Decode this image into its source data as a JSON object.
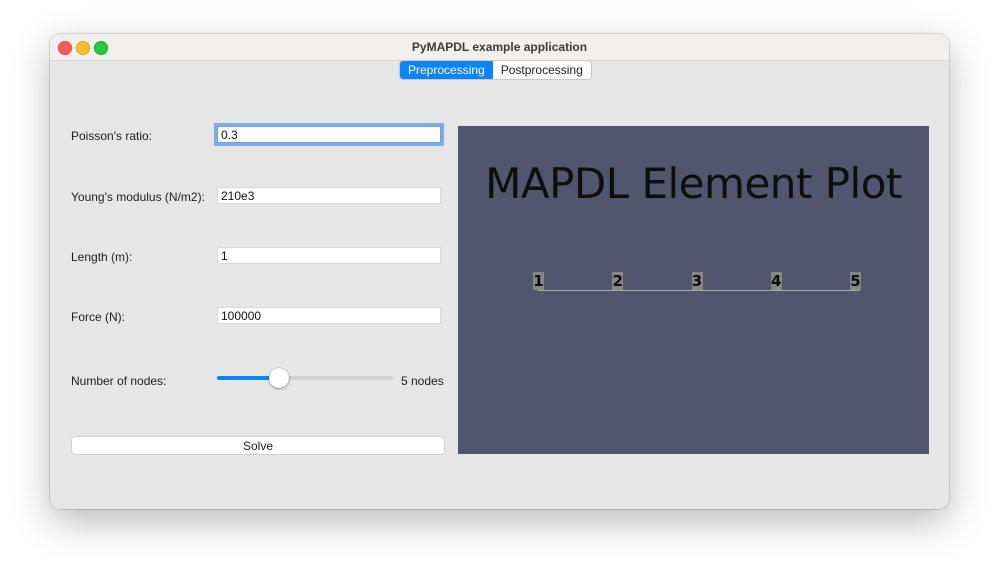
{
  "window": {
    "title": "PyMAPDL example application"
  },
  "tabs": [
    {
      "label": "Preprocessing",
      "active": true
    },
    {
      "label": "Postprocessing",
      "active": false
    }
  ],
  "form": {
    "poisson": {
      "label": "Poisson's ratio:",
      "value": "0.3"
    },
    "young": {
      "label": "Young's modulus (N/m2):",
      "value": "210e3"
    },
    "length": {
      "label": "Length (m):",
      "value": "1"
    },
    "force": {
      "label": "Force (N):",
      "value": "100000"
    },
    "nodes": {
      "label": "Number of nodes:",
      "value": 5,
      "value_text": "5 nodes",
      "fraction": 0.35
    },
    "solve_label": "Solve"
  },
  "plot": {
    "title": "MAPDL Element Plot",
    "nodes": [
      "1",
      "2",
      "3",
      "4",
      "5"
    ]
  },
  "colors": {
    "accent": "#0a84ff",
    "plot_background": "#51566f",
    "window_background": "#e6e6e6"
  }
}
